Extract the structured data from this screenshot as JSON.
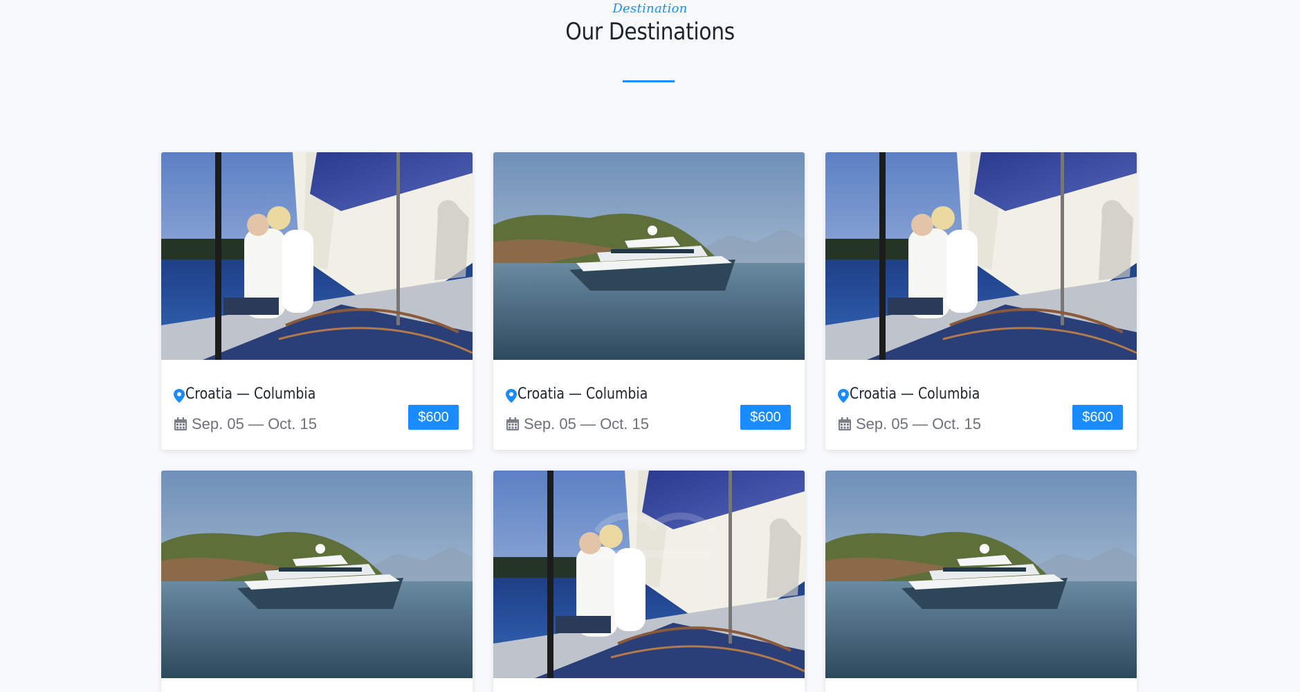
{
  "section": {
    "subtitle": "Destination",
    "title": "Our Destinations",
    "accent_color": "#1a8cff"
  },
  "cards": [
    {
      "image": "sailboat-couple-photo",
      "location": "Croatia — Columbia",
      "dates": "Sep. 05 — Oct. 15",
      "price": "$600"
    },
    {
      "image": "yacht-bay-photo",
      "location": "Croatia — Columbia",
      "dates": "Sep. 05 — Oct. 15",
      "price": "$600"
    },
    {
      "image": "sailboat-couple-photo",
      "location": "Croatia — Columbia",
      "dates": "Sep. 05 — Oct. 15",
      "price": "$600"
    },
    {
      "image": "yacht-bay-photo"
    },
    {
      "image": "sailboat-couple-photo"
    },
    {
      "image": "yacht-bay-photo"
    }
  ],
  "icons": {
    "location": "map-pin-icon",
    "date": "calendar-icon"
  }
}
